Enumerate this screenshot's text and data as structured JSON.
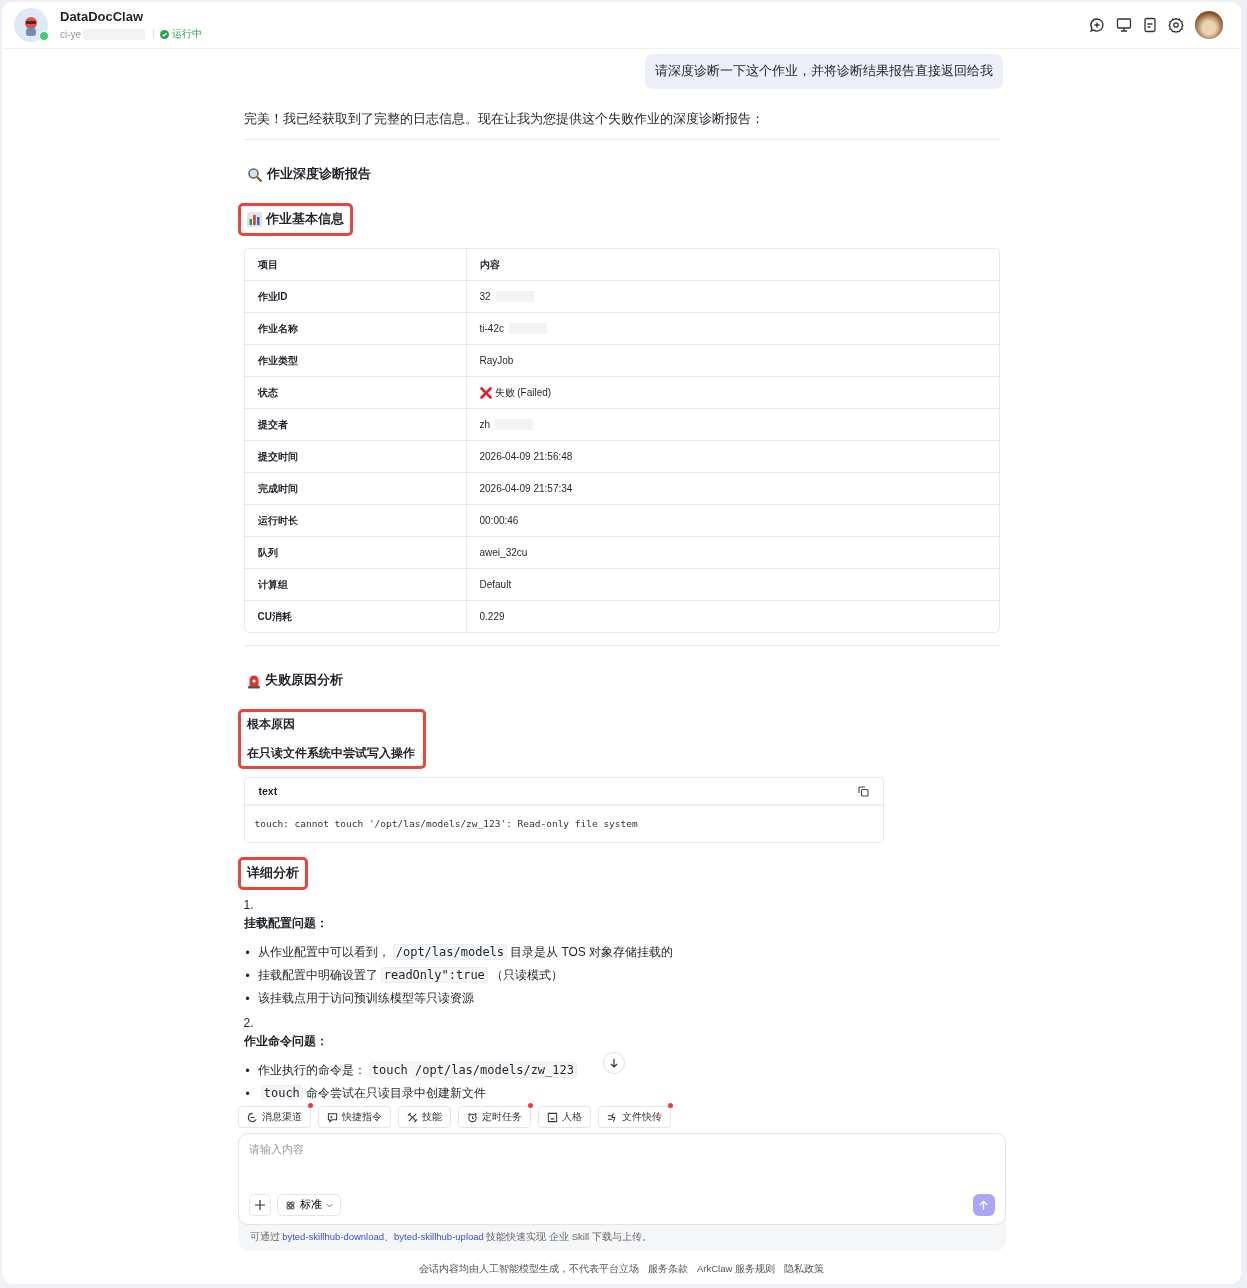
{
  "header": {
    "app_name": "DataDocClaw",
    "instance": "ci-ye",
    "instance_redacted": true,
    "status": "运行中",
    "online": true
  },
  "messages": {
    "user": "请深度诊断一下这个作业，并将诊断结果报告直接返回给我",
    "intro": "完美！我已经获取到了完整的日志信息。现在让我为您提供这个失败作业的深度诊断报告：",
    "report_title": {
      "text": "作业深度诊断报告",
      "highlighted": false
    },
    "basic_title": {
      "text": "作业基本信息",
      "highlighted": true
    },
    "table": {
      "columns": [
        "项目",
        "内容"
      ],
      "rows": [
        {
          "label": "作业ID",
          "value": "32",
          "redacted": true,
          "kind": "text"
        },
        {
          "label": "作业名称",
          "value": "ti-42c",
          "redacted": true,
          "kind": "text"
        },
        {
          "label": "作业类型",
          "value": "RayJob",
          "redacted": false,
          "kind": "text"
        },
        {
          "label": "状态",
          "value": "失败 (Failed)",
          "redacted": false,
          "kind": "failed"
        },
        {
          "label": "提交者",
          "value": "zh",
          "redacted": true,
          "kind": "text"
        },
        {
          "label": "提交时间",
          "value": "2026-04-09 21:56:48",
          "redacted": false,
          "kind": "text"
        },
        {
          "label": "完成时间",
          "value": "2026-04-09 21:57:34",
          "redacted": false,
          "kind": "text"
        },
        {
          "label": "运行时长",
          "value": "00:00:46",
          "redacted": false,
          "kind": "text"
        },
        {
          "label": "队列",
          "value": "awei_32cu",
          "redacted": false,
          "kind": "text"
        },
        {
          "label": "计算组",
          "value": "Default",
          "redacted": false,
          "kind": "text"
        },
        {
          "label": "CU消耗",
          "value": "0.229",
          "redacted": false,
          "kind": "text"
        }
      ]
    },
    "failure_title": {
      "text": "失败原因分析",
      "highlighted": false
    },
    "root_cause": {
      "title": "根本原因",
      "summary": "在只读文件系统中尝试写入操作",
      "highlighted": true
    },
    "code_block": {
      "language": "text",
      "code": "touch: cannot touch '/opt/las/models/zw_123': Read-only file system"
    },
    "detail_title": {
      "text": "详细分析",
      "highlighted": true
    },
    "sections": [
      {
        "number": "1.",
        "title": "挂载配置问题：",
        "bullets": [
          {
            "marker": "•",
            "parts": [
              {
                "kind": "text",
                "text": "从作业配置中可以看到，"
              },
              {
                "kind": "code",
                "text": "/opt/las/models"
              },
              {
                "kind": "text",
                "text": "目录是从 TOS 对象存储挂载的"
              }
            ]
          },
          {
            "marker": "•",
            "parts": [
              {
                "kind": "text",
                "text": "挂载配置中明确设置了"
              },
              {
                "kind": "code",
                "text": "readOnly\":true"
              },
              {
                "kind": "text",
                "text": "（只读模式）"
              }
            ]
          },
          {
            "marker": "•",
            "parts": [
              {
                "kind": "text",
                "text": "该挂载点用于访问预训练模型等只读资源"
              }
            ]
          }
        ]
      },
      {
        "number": "2.",
        "title": "作业命令问题：",
        "bullets": [
          {
            "marker": "•",
            "parts": [
              {
                "kind": "text",
                "text": "作业执行的命令是："
              },
              {
                "kind": "code",
                "text": "touch /opt/las/models/zw_123"
              }
            ]
          },
          {
            "marker": "•",
            "parts": [
              {
                "kind": "code",
                "text": "touch"
              },
              {
                "kind": "text",
                "text": "命令尝试在只读目录中创建新文件"
              }
            ]
          }
        ]
      }
    ]
  },
  "toolbar": [
    {
      "label": "消息渠道",
      "dot": true
    },
    {
      "label": "快捷指令",
      "dot": false
    },
    {
      "label": "技能",
      "dot": false
    },
    {
      "label": "定时任务",
      "dot": true
    },
    {
      "label": "人格",
      "dot": false
    },
    {
      "label": "文件快传",
      "dot": true
    }
  ],
  "composer": {
    "placeholder": "请输入内容",
    "mode": "标准"
  },
  "hint": {
    "before": "可通过 ",
    "link1": "byted-skillhub-download",
    "sep": "、",
    "link2": "byted-skillhub-upload",
    "after": " 技能快速实现 企业 Skill 下载与上传。"
  },
  "footer": [
    "会话内容均由人工智能模型生成，不代表平台立场",
    "服务条款",
    "ArkClaw 服务规则",
    "隐私政策"
  ]
}
